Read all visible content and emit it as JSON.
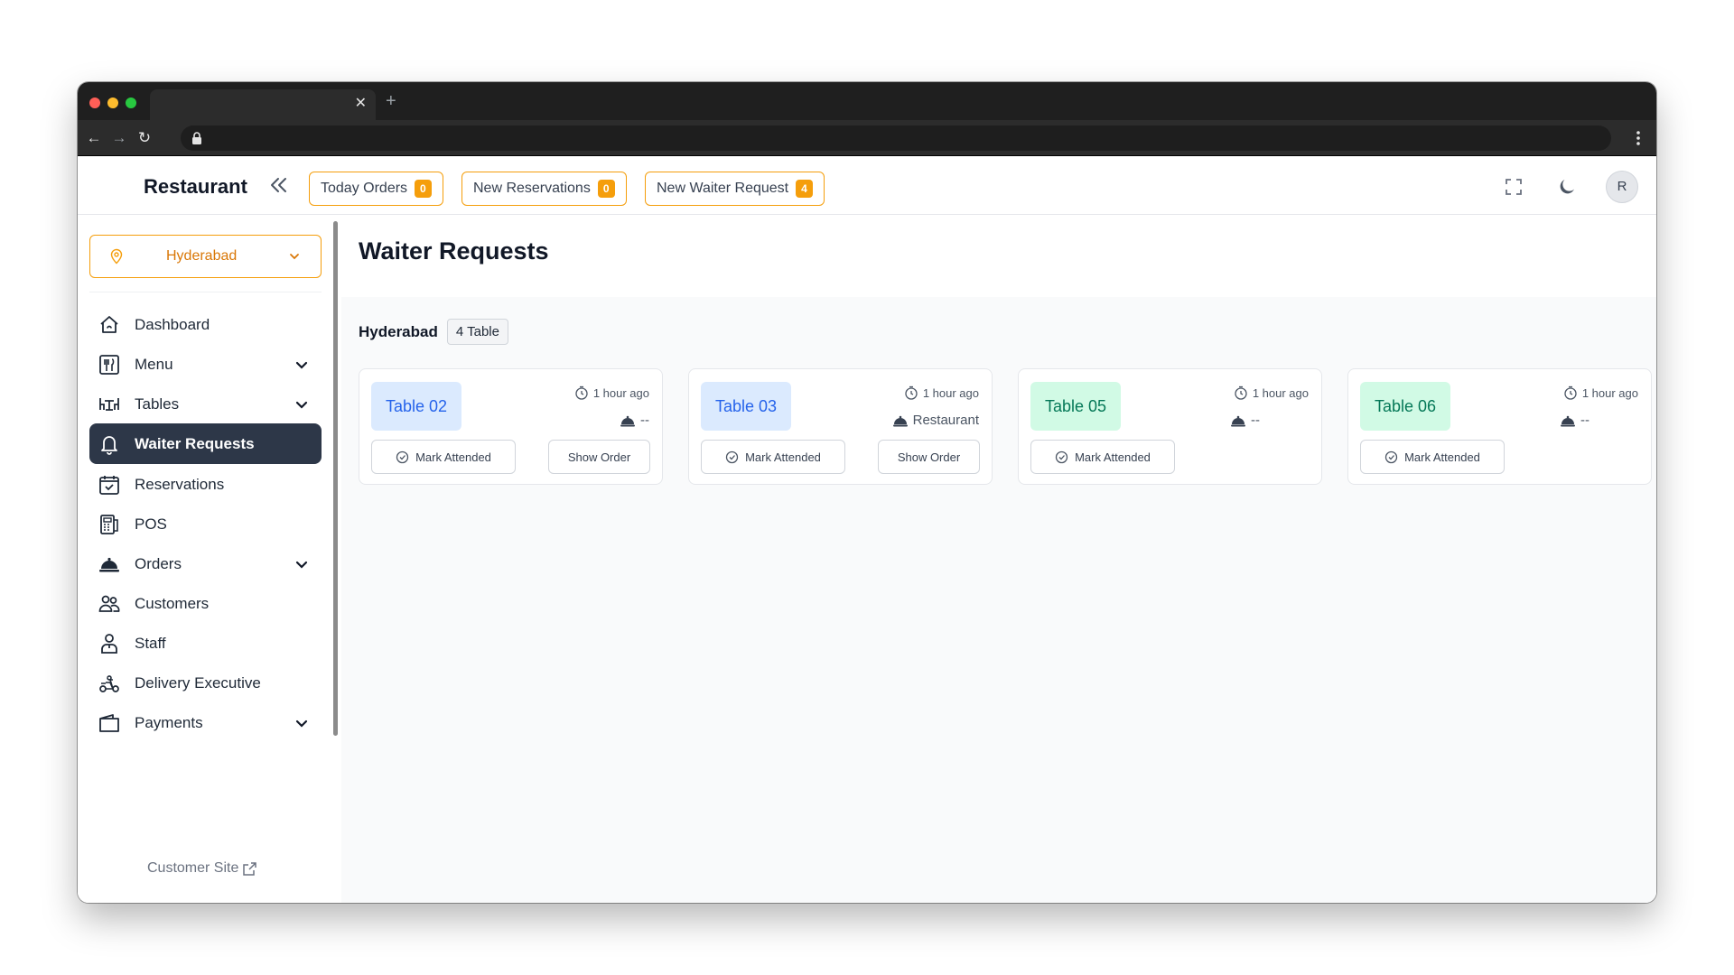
{
  "header": {
    "brand": "Restaurant",
    "buttons": [
      {
        "label": "Today Orders",
        "count": "0"
      },
      {
        "label": "New Reservations",
        "count": "0"
      },
      {
        "label": "New Waiter Request",
        "count": "4"
      }
    ],
    "avatar_initial": "R"
  },
  "sidebar": {
    "location": "Hyderabad",
    "items": [
      {
        "label": "Dashboard",
        "icon": "home-icon"
      },
      {
        "label": "Menu",
        "icon": "menu-icon"
      },
      {
        "label": "Tables",
        "icon": "tables-icon"
      },
      {
        "label": "Waiter Requests",
        "icon": "bell-icon"
      },
      {
        "label": "Reservations",
        "icon": "calendar-icon"
      },
      {
        "label": "POS",
        "icon": "pos-icon"
      },
      {
        "label": "Orders",
        "icon": "cloche-icon"
      },
      {
        "label": "Customers",
        "icon": "users-icon"
      },
      {
        "label": "Staff",
        "icon": "staff-icon"
      },
      {
        "label": "Delivery Executive",
        "icon": "scooter-icon"
      },
      {
        "label": "Payments",
        "icon": "wallet-icon"
      }
    ],
    "customer_site": "Customer Site"
  },
  "main": {
    "title": "Waiter Requests",
    "area": "Hyderabad",
    "table_count": "4 Table",
    "cards": [
      {
        "table": "Table 02",
        "time": "1 hour ago",
        "source": "--",
        "mark_label": "Mark Attended",
        "show_label": "Show Order"
      },
      {
        "table": "Table 03",
        "time": "1 hour ago",
        "source": "Restaurant",
        "mark_label": "Mark Attended",
        "show_label": "Show Order"
      },
      {
        "table": "Table 05",
        "time": "1 hour ago",
        "source": "--",
        "mark_label": "Mark Attended"
      },
      {
        "table": "Table 06",
        "time": "1 hour ago",
        "source": "--",
        "mark_label": "Mark Attended"
      }
    ]
  },
  "colors": {
    "accent": "#f59e0b",
    "active_nav": "#2d3748",
    "table_blue": "#2563eb",
    "table_green": "#047857"
  }
}
